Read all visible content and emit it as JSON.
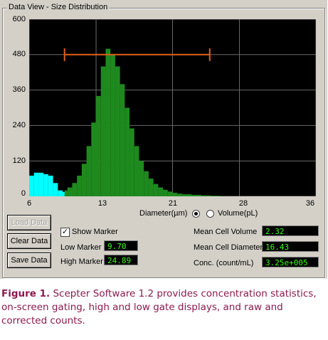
{
  "window": {
    "group_title": "Data View - Size Distribution"
  },
  "chart_data": {
    "type": "bar",
    "title": "",
    "xlabel": "Diameter(µm)",
    "ylabel": "",
    "xlim": [
      6,
      36
    ],
    "ylim": [
      0,
      600
    ],
    "xticks": [
      "6",
      "13",
      "21",
      "28",
      "36"
    ],
    "yticks": [
      "600",
      "480",
      "360",
      "240",
      "120",
      "0"
    ],
    "grid": true,
    "gate_marker": {
      "low": 9.7,
      "high": 24.89,
      "level": 480
    },
    "low_region": {
      "color": "#00ffff",
      "x": [
        6.0,
        6.5,
        7.0,
        7.5,
        8.0,
        8.5,
        9.0,
        9.5
      ],
      "y": [
        70,
        80,
        80,
        75,
        70,
        45,
        20,
        15
      ]
    },
    "main_region": {
      "color": "#1e8a1e",
      "x": [
        9.7,
        10.0,
        10.5,
        11.0,
        11.5,
        12.0,
        12.5,
        13.0,
        13.5,
        14.0,
        14.5,
        15.0,
        15.5,
        16.0,
        16.5,
        17.0,
        17.5,
        18.0,
        18.5,
        19.0,
        19.5,
        20.0,
        20.5,
        21.0,
        21.5,
        22.0,
        23.0,
        24.0,
        25.0,
        26.0
      ],
      "y": [
        20,
        30,
        45,
        70,
        110,
        170,
        250,
        340,
        440,
        500,
        480,
        440,
        380,
        300,
        230,
        170,
        120,
        85,
        60,
        42,
        30,
        22,
        16,
        12,
        9,
        7,
        5,
        3,
        2,
        1
      ]
    }
  },
  "radio": {
    "diameter_label": "Diameter(µm)",
    "volume_label": "Volume(pL)",
    "selected": "diameter"
  },
  "buttons": {
    "load": "Load Data",
    "clear": "Clear Data",
    "save": "Save Data"
  },
  "marker": {
    "show_label": "Show Marker",
    "checked": true,
    "low_label": "Low Marker",
    "low_value": "9.70",
    "high_label": "High Marker",
    "high_value": "24.89"
  },
  "stats": {
    "mcv_label": "Mean Cell Volume",
    "mcv_value": "2.32",
    "mcd_label": "Mean Cell Diameter",
    "mcd_value": "16.43",
    "conc_label": "Conc. (count/mL)",
    "conc_value": "3.25e+005"
  },
  "caption": {
    "lead": "Figure 1.",
    "text": " Scepter Software 1.2 provides concentration statistics, on-screen gating, high and low gate displays, and raw and corrected counts."
  }
}
